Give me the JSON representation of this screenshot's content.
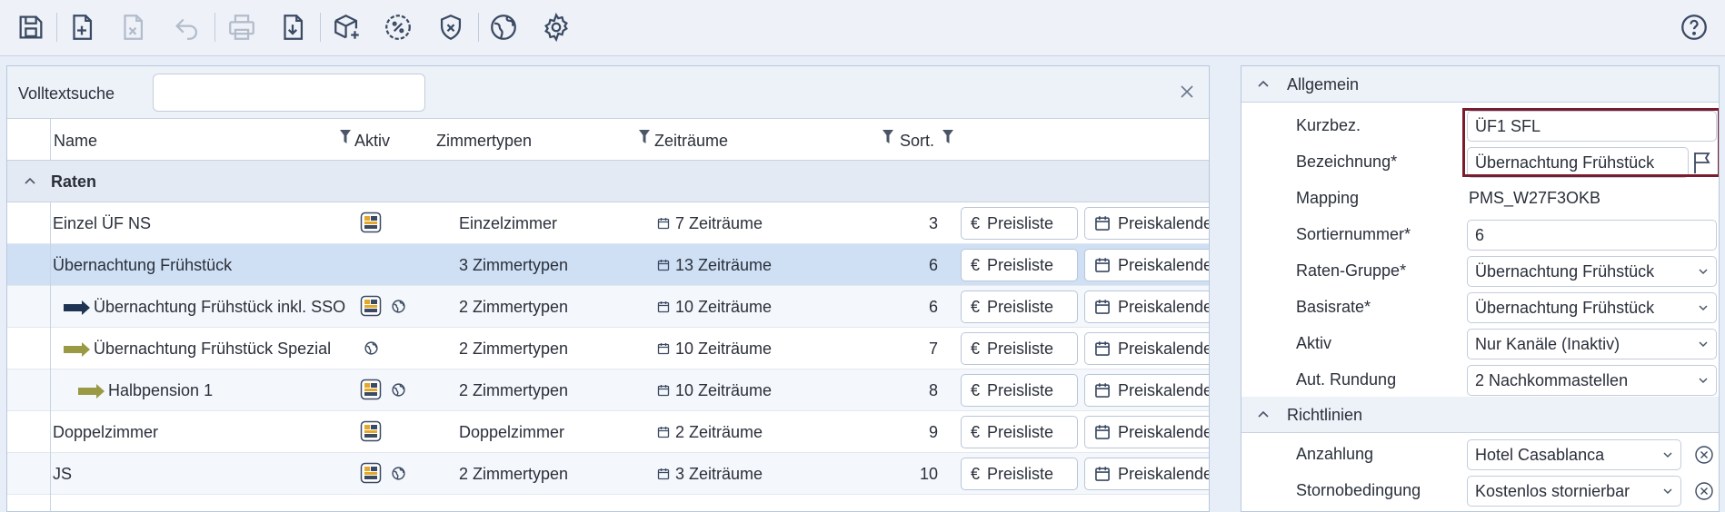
{
  "toolbar": {
    "icons": [
      "save-icon",
      "new-document-icon",
      "delete-document-icon",
      "undo-icon",
      "print-icon",
      "download-icon",
      "add-package-icon",
      "discount-icon",
      "shield-x-icon",
      "globe-icon",
      "gear-icon",
      "help-icon"
    ]
  },
  "search": {
    "label": "Volltextsuche",
    "value": "",
    "placeholder": ""
  },
  "table": {
    "columns": [
      "Name",
      "Aktiv",
      "Zimmertypen",
      "Zeiträume",
      "Sort."
    ],
    "group": "Raten",
    "button_preisliste": "Preisliste",
    "button_preiskalender": "Preiskalender",
    "rows": [
      {
        "name": "Einzel ÜF NS",
        "zimmertypen": "Einzelzimmer",
        "zeitraeume": "7 Zeiträume",
        "sort": "3"
      },
      {
        "name": "Übernachtung Frühstück",
        "zimmertypen": "3 Zimmertypen",
        "zeitraeume": "13 Zeiträume",
        "sort": "6"
      },
      {
        "name": "Übernachtung Frühstück inkl. SSO",
        "zimmertypen": "2 Zimmertypen",
        "zeitraeume": "10 Zeiträume",
        "sort": "6"
      },
      {
        "name": "Übernachtung Frühstück Spezial",
        "zimmertypen": "2 Zimmertypen",
        "zeitraeume": "10 Zeiträume",
        "sort": "7"
      },
      {
        "name": "Halbpension 1",
        "zimmertypen": "2 Zimmertypen",
        "zeitraeume": "10 Zeiträume",
        "sort": "8"
      },
      {
        "name": "Doppelzimmer",
        "zimmertypen": "Doppelzimmer",
        "zeitraeume": "2 Zeiträume",
        "sort": "9"
      },
      {
        "name": "JS",
        "zimmertypen": "2 Zimmertypen",
        "zeitraeume": "3 Zeiträume",
        "sort": "10"
      }
    ]
  },
  "details": {
    "section_general": "Allgemein",
    "section_policies": "Richtlinien",
    "fields": {
      "kurzbez_label": "Kurzbez.",
      "kurzbez_value": "ÜF1 SFL",
      "bezeichnung_label": "Bezeichnung*",
      "bezeichnung_value": "Übernachtung Frühstück",
      "mapping_label": "Mapping",
      "mapping_value": "PMS_W27F3OKB",
      "sortiernummer_label": "Sortiernummer*",
      "sortiernummer_value": "6",
      "ratengruppe_label": "Raten-Gruppe*",
      "ratengruppe_value": "Übernachtung Frühstück",
      "basisrate_label": "Basisrate*",
      "basisrate_value": "Übernachtung Frühstück",
      "aktiv_label": "Aktiv",
      "aktiv_value": "Nur Kanäle (Inaktiv)",
      "rundung_label": "Aut. Rundung",
      "rundung_value": "2 Nachkommastellen",
      "anzahlung_label": "Anzahlung",
      "anzahlung_value": "Hotel Casablanca",
      "storno_label": "Stornobedingung",
      "storno_value": "Kostenlos stornierbar"
    }
  },
  "colors": {
    "accent_border": "#7a1c2e",
    "arrow_dark": "#1f3352",
    "arrow_olive": "#9a9a45",
    "selected_row": "#cfe0f5"
  }
}
